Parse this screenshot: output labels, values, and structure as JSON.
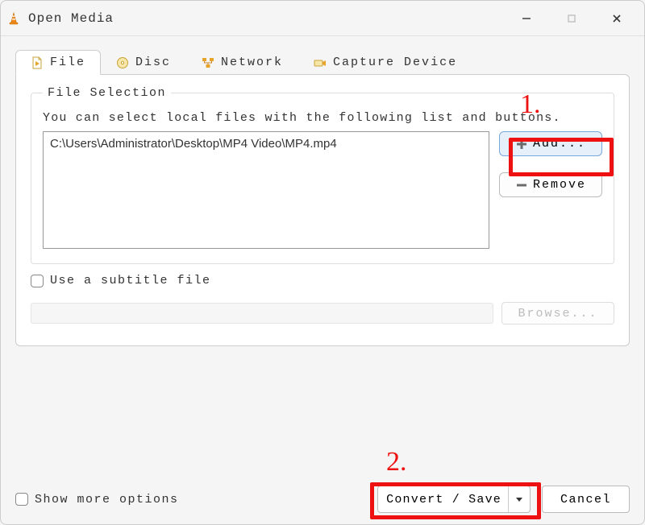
{
  "window": {
    "title": "Open Media"
  },
  "tabs": {
    "file": "File",
    "disc": "Disc",
    "network": "Network",
    "capture": "Capture Device"
  },
  "file_selection": {
    "legend": "File Selection",
    "hint": "You can select local files with the following list and buttons.",
    "files": [
      "C:\\Users\\Administrator\\Desktop\\MP4 Video\\MP4.mp4"
    ],
    "add_label": "Add...",
    "remove_label": "Remove"
  },
  "subtitle": {
    "checkbox_label": "Use a subtitle file",
    "browse_label": "Browse..."
  },
  "footer": {
    "more_options_label": "Show more options",
    "convert_label": "Convert / Save",
    "cancel_label": "Cancel"
  },
  "annotations": {
    "one": "1.",
    "two": "2."
  }
}
